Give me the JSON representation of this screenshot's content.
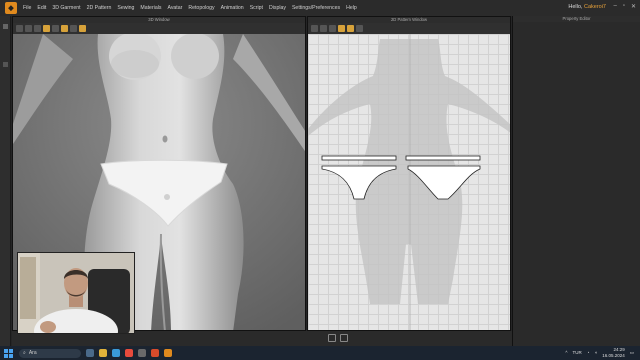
{
  "app": {
    "menu": [
      "File",
      "Edit",
      "3D Garment",
      "2D Pattern",
      "Sewing",
      "Materials",
      "Avatar",
      "Retopology",
      "Animation",
      "Script",
      "Display",
      "Settings/Preferences",
      "Help"
    ],
    "greeting": "Hello,",
    "user": "Cakeroi7"
  },
  "panels": {
    "window_3d_title": "3D Window",
    "window_2d_title": "2D Pattern Window",
    "property_title": "Property Editor"
  },
  "taskbar": {
    "search_placeholder": "Ara",
    "language": "TUR",
    "time": "24:29",
    "date": "16.05.2024"
  },
  "colors": {
    "accent": "#e08a1e",
    "viewport_2d_bg": "#e6e6e6",
    "viewport_3d_bg": "#6b6b6b"
  }
}
